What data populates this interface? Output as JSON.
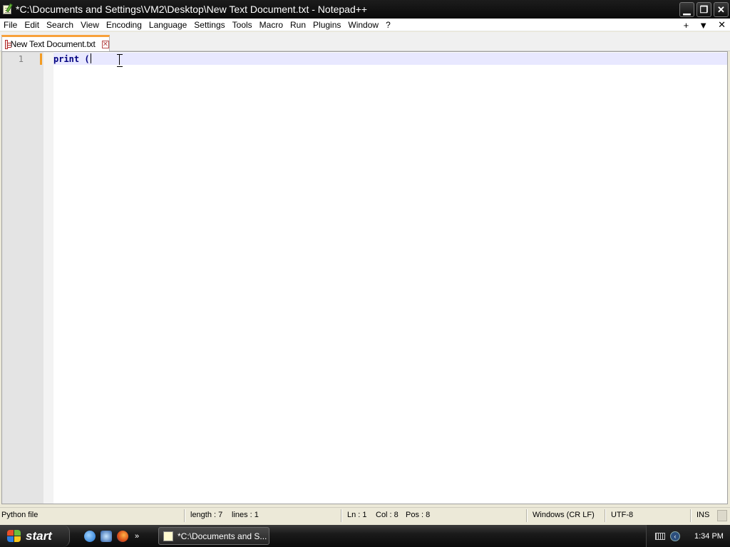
{
  "window": {
    "title": "*C:\\Documents and Settings\\VM2\\Desktop\\New Text Document.txt - Notepad++",
    "minimize_glyph": "▁",
    "restore_glyph": "❐",
    "close_glyph": "✕"
  },
  "menu": {
    "items": [
      "File",
      "Edit",
      "Search",
      "View",
      "Encoding",
      "Language",
      "Settings",
      "Tools",
      "Macro",
      "Run",
      "Plugins",
      "Window",
      "?"
    ],
    "right_plus": "+",
    "right_dropdown": "▼",
    "right_close": "✕"
  },
  "tabs": [
    {
      "label": "New Text Document.txt",
      "close_glyph": "✕",
      "modified": true
    }
  ],
  "editor": {
    "lines": [
      {
        "number": "1",
        "keyword": "print",
        "rest": " ("
      }
    ],
    "language_colors": {
      "keyword": "#000080",
      "current_line": "#e8e8ff",
      "change_marker": "#f39c23"
    }
  },
  "status": {
    "file_type": "Python file",
    "length": "length : 7",
    "lines": "lines : 1",
    "ln": "Ln : 1",
    "col": "Col : 8",
    "pos": "Pos : 8",
    "eol": "Windows (CR LF)",
    "encoding": "UTF-8",
    "mode": "INS"
  },
  "taskbar": {
    "start_label": "start",
    "quick_launch": [
      "internet-explorer-icon",
      "windows-media-icon",
      "firefox-icon"
    ],
    "more_glyph": "»",
    "task_label": "*C:\\Documents and S...",
    "clock": "1:34 PM",
    "tray_chevron": "‹"
  }
}
